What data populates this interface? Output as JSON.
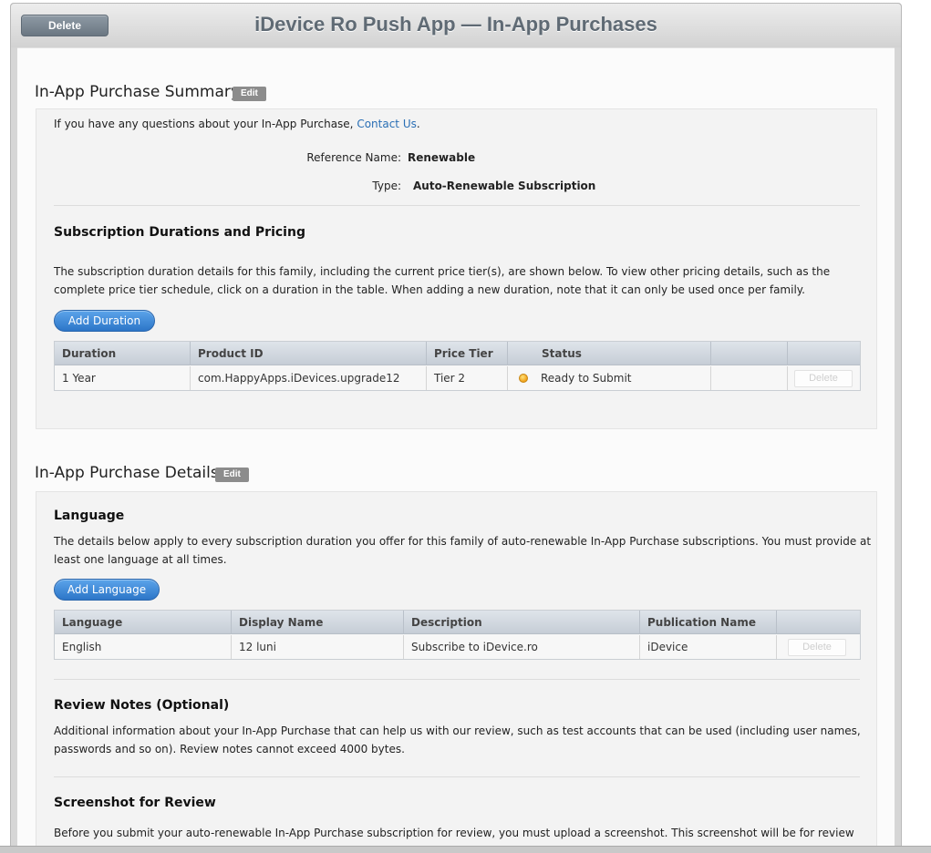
{
  "header": {
    "delete_label": "Delete",
    "title": "iDevice Ro Push App — In-App Purchases"
  },
  "summary": {
    "title": "In-App Purchase Summary",
    "edit_label": "Edit",
    "question_text": "If you have any questions about your In-App Purchase, ",
    "contact_link": "Contact Us",
    "question_end": ".",
    "reference_label": "Reference Name:",
    "reference_value": "Renewable",
    "type_label": "Type:",
    "type_value": "Auto-Renewable Subscription",
    "durations_heading": "Subscription Durations and Pricing",
    "durations_desc_1": "The subscription duration details for this family, including the current price tier(s), are shown below. To view other pricing details, such as the",
    "durations_desc_2": "complete price tier schedule, click on a duration in the table. When adding a new duration, note that it can only be used once per family.",
    "add_duration_label": "Add Duration",
    "table": {
      "headers": [
        "Duration",
        "Product ID",
        "Price Tier",
        "Status"
      ],
      "rows": [
        {
          "duration": "1 Year",
          "product_id": "com.HappyApps.iDevices.upgrade12",
          "price_tier": "Tier 2",
          "status": "Ready to Submit",
          "delete_label": "Delete"
        }
      ]
    }
  },
  "details": {
    "title": "In-App Purchase Details",
    "edit_label": "Edit",
    "language_heading": "Language",
    "language_desc_1": "The details below apply to every subscription duration you offer for this family of auto-renewable In-App Purchase subscriptions. You must provide at",
    "language_desc_2": "least one language at all times.",
    "add_language_label": "Add Language",
    "table": {
      "headers": [
        "Language",
        "Display Name",
        "Description",
        "Publication Name"
      ],
      "rows": [
        {
          "language": "English",
          "display_name": "12 luni",
          "description": "Subscribe to iDevice.ro",
          "publication_name": "iDevice",
          "delete_label": "Delete"
        }
      ]
    },
    "review_heading": "Review Notes (Optional)",
    "review_desc_1": "Additional information about your In-App Purchase that can help us with our review, such as test accounts that can be used (including user names,",
    "review_desc_2": "passwords and so on). Review notes cannot exceed 4000 bytes.",
    "screenshot_heading": "Screenshot for Review",
    "screenshot_desc_1": "Before you submit your auto-renewable In-App Purchase subscription for review, you must upload a screenshot. This screenshot will be for review"
  },
  "colors": {
    "accent_button": "#2d76c8",
    "link": "#2a6fb5",
    "status_pending": "#f0a01a"
  }
}
